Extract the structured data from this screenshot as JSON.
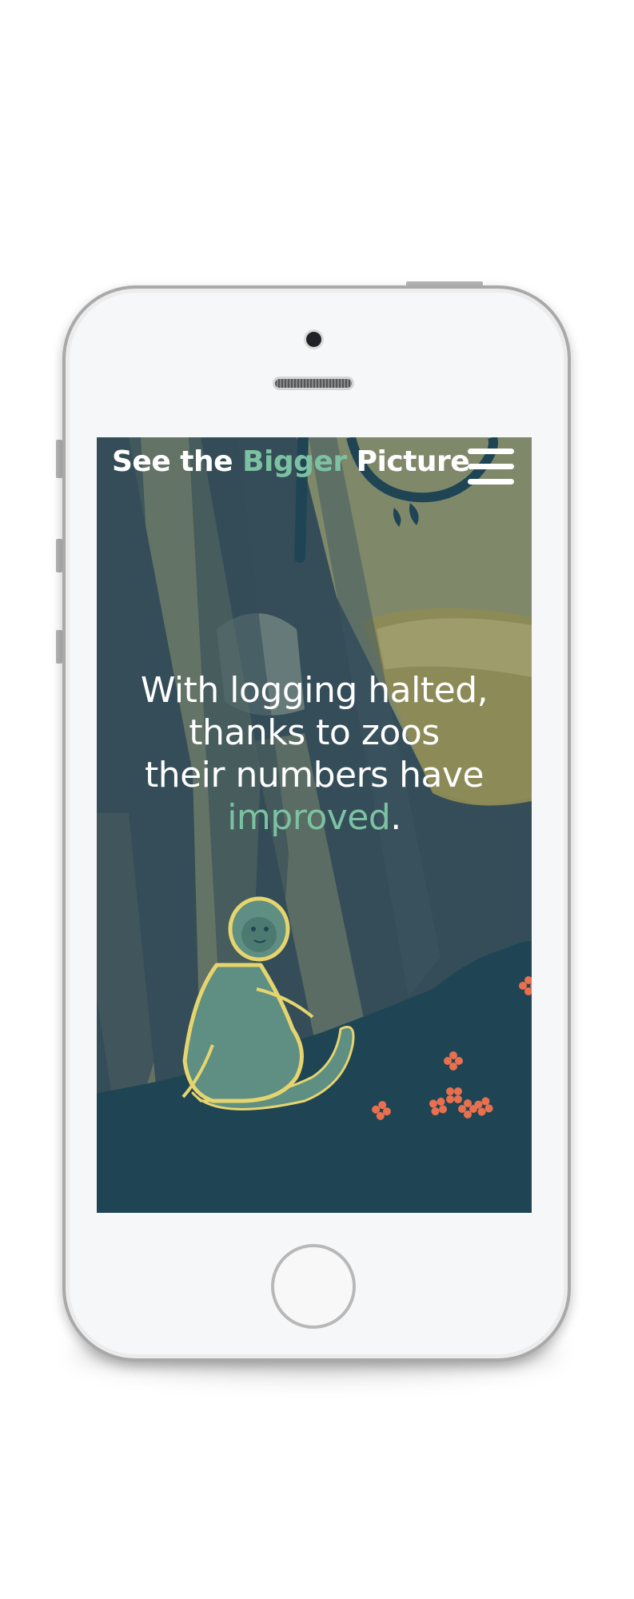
{
  "header": {
    "title_part1": "See the ",
    "title_accent": "Bigger",
    "title_part2": " Picture",
    "menu_icon": "hamburger-icon"
  },
  "hero": {
    "line1": "With logging halted,",
    "line2": "thanks to zoos",
    "line3": "their numbers have",
    "line4_accent": "improved",
    "line4_end": "."
  },
  "colors": {
    "accent": "#7cc2a2",
    "background": "#344d59",
    "ground": "#1f4555",
    "monkey_outline": "#e6d56e",
    "flowers": "#e8704f"
  }
}
